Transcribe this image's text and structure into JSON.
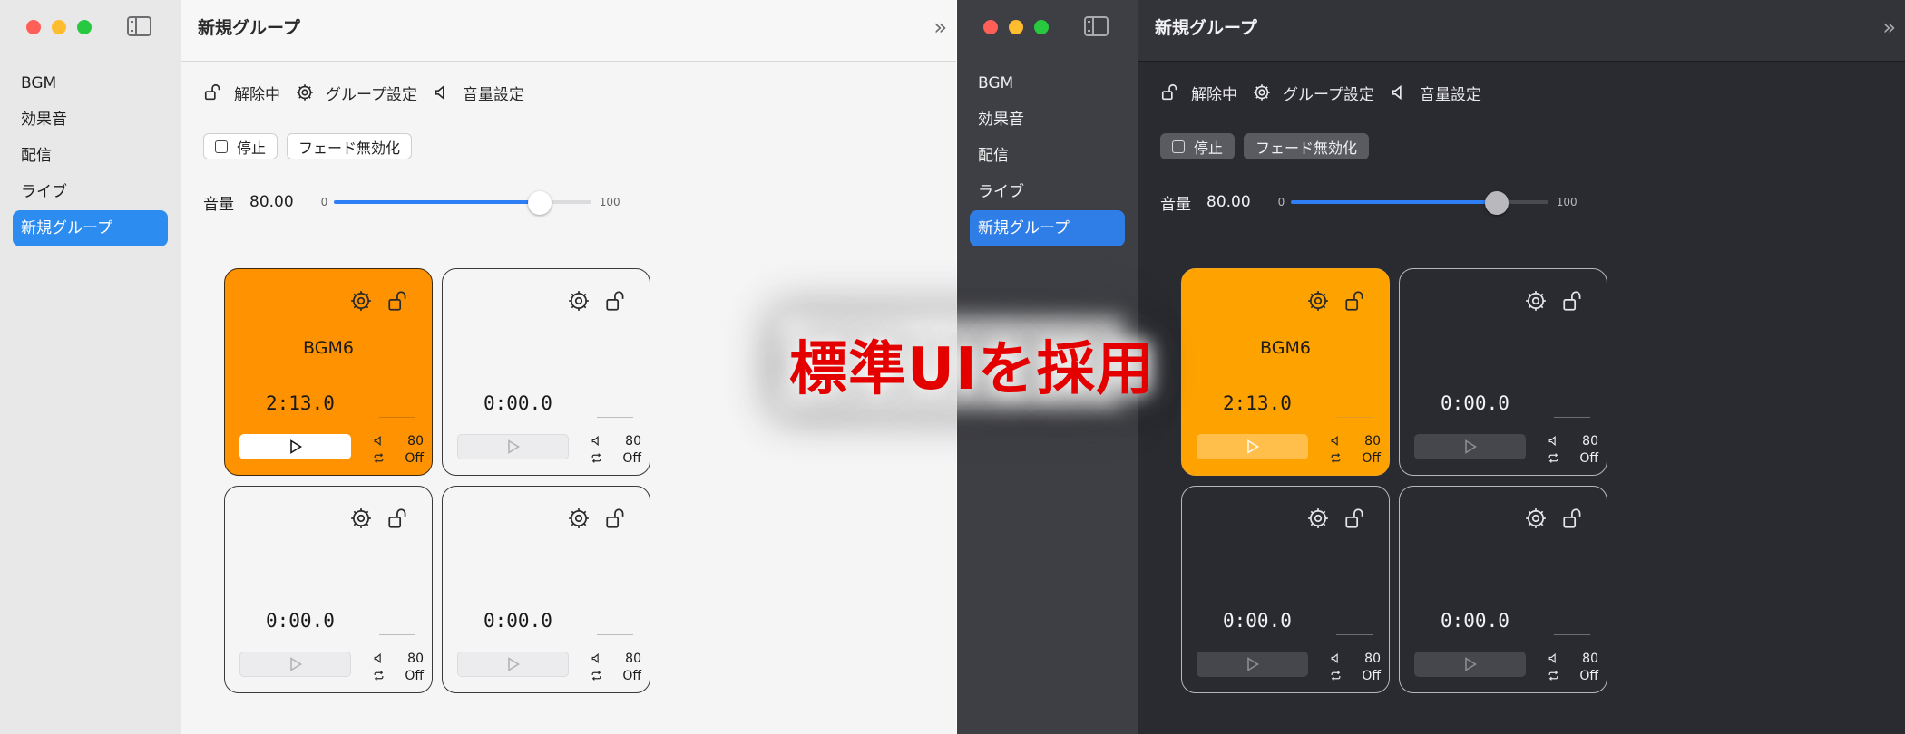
{
  "windows": [
    {
      "theme": "light",
      "sidebar": {
        "items": [
          "BGM",
          "効果音",
          "配信",
          "ライブ",
          "新規グループ"
        ],
        "active_index": 4
      },
      "title": "新規グループ",
      "toolbar": {
        "lock_label": "解除中",
        "group_settings_label": "グループ設定",
        "volume_settings_label": "音量設定"
      },
      "buttons": {
        "stop_label": "停止",
        "fade_label": "フェード無効化"
      },
      "volume": {
        "label": "音量",
        "value": "80.00",
        "min": "0",
        "max": "100",
        "level": 80
      },
      "cards": [
        {
          "name": "BGM6",
          "time": "2:13.0",
          "volume": "80",
          "loop": "Off",
          "active": true
        },
        {
          "name": "",
          "time": "0:00.0",
          "volume": "80",
          "loop": "Off",
          "active": false
        },
        {
          "name": "",
          "time": "0:00.0",
          "volume": "80",
          "loop": "Off",
          "active": false
        },
        {
          "name": "",
          "time": "0:00.0",
          "volume": "80",
          "loop": "Off",
          "active": false
        }
      ]
    },
    {
      "theme": "dark",
      "sidebar": {
        "items": [
          "BGM",
          "効果音",
          "配信",
          "ライブ",
          "新規グループ"
        ],
        "active_index": 4
      },
      "title": "新規グループ",
      "toolbar": {
        "lock_label": "解除中",
        "group_settings_label": "グループ設定",
        "volume_settings_label": "音量設定"
      },
      "buttons": {
        "stop_label": "停止",
        "fade_label": "フェード無効化"
      },
      "volume": {
        "label": "音量",
        "value": "80.00",
        "min": "0",
        "max": "100",
        "level": 80
      },
      "cards": [
        {
          "name": "BGM6",
          "time": "2:13.0",
          "volume": "80",
          "loop": "Off",
          "active": true
        },
        {
          "name": "",
          "time": "0:00.0",
          "volume": "80",
          "loop": "Off",
          "active": false
        },
        {
          "name": "",
          "time": "0:00.0",
          "volume": "80",
          "loop": "Off",
          "active": false
        },
        {
          "name": "",
          "time": "0:00.0",
          "volume": "80",
          "loop": "Off",
          "active": false
        }
      ]
    }
  ],
  "banner": {
    "text": "標準UIを採用"
  },
  "icons": [
    "sidebar-toggle-icon",
    "chevrons-right-icon",
    "unlock-icon",
    "gear-icon",
    "speaker-icon",
    "checkbox-icon",
    "play-icon",
    "repeat-icon"
  ],
  "colors": {
    "accent": "#2d8cf0",
    "active_card_light": "#fe9200",
    "active_card_dark": "#fea200",
    "banner_text": "#e50000"
  }
}
